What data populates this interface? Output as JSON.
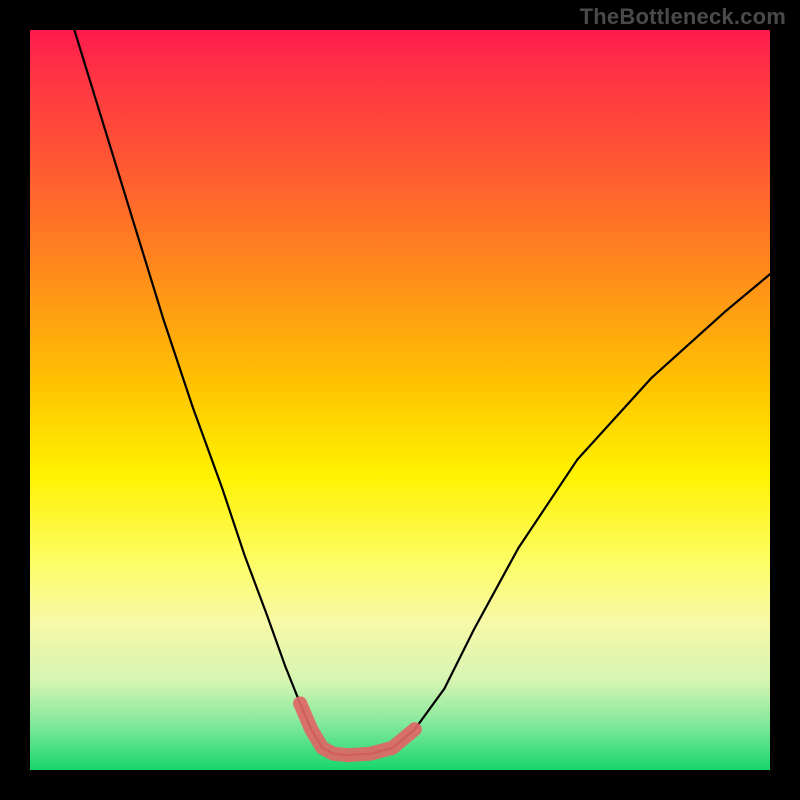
{
  "watermark": "TheBottleneck.com",
  "chart_data": {
    "type": "line",
    "title": "",
    "xlabel": "",
    "ylabel": "",
    "xlim": [
      0,
      100
    ],
    "ylim": [
      0,
      100
    ],
    "series": [
      {
        "name": "bottleneck-curve",
        "x": [
          6,
          10,
          14,
          18,
          22,
          26,
          29,
          32,
          34.5,
          36.5,
          38,
          39.5,
          41,
          43,
          46,
          49,
          52,
          56,
          60,
          66,
          74,
          84,
          94,
          100
        ],
        "values": [
          100,
          87,
          74,
          61,
          49,
          38,
          29,
          21,
          14,
          9,
          5.5,
          3,
          2.2,
          2,
          2.2,
          3,
          5.5,
          11,
          19,
          30,
          42,
          53,
          62,
          67
        ]
      },
      {
        "name": "bottleneck-highlight",
        "x": [
          36.5,
          38,
          39.5,
          41,
          43,
          46,
          49,
          52
        ],
        "values": [
          9,
          5.5,
          3,
          2.2,
          2,
          2.2,
          3,
          5.5
        ]
      }
    ],
    "gradient_stops": [
      {
        "pos": 0.0,
        "color": "#ff1a4d"
      },
      {
        "pos": 0.18,
        "color": "#ff5733"
      },
      {
        "pos": 0.48,
        "color": "#ffc300"
      },
      {
        "pos": 0.72,
        "color": "#fdfd66"
      },
      {
        "pos": 0.94,
        "color": "#7fe89a"
      },
      {
        "pos": 1.0,
        "color": "#17d66b"
      }
    ]
  }
}
